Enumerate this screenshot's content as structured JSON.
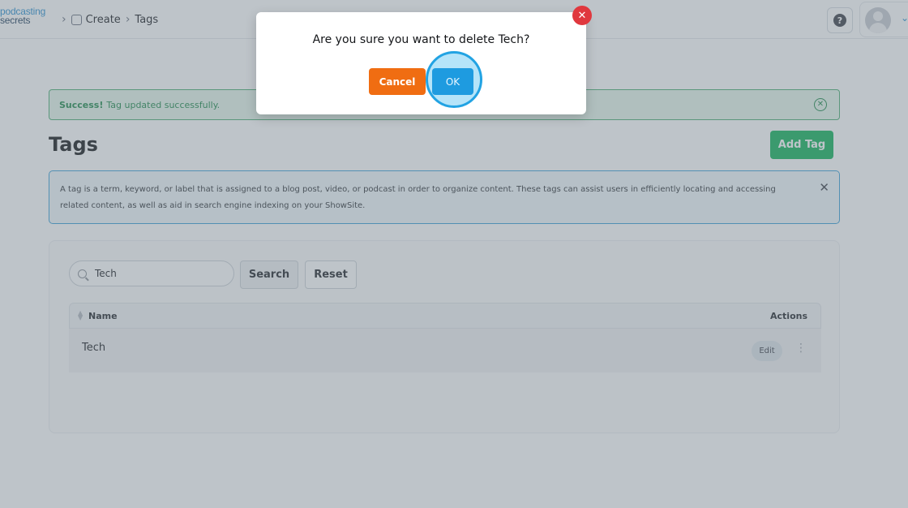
{
  "header": {
    "logo_line1": "podcasting",
    "logo_line2": "secrets",
    "breadcrumb": [
      "Create",
      "Tags"
    ],
    "help_label": "?"
  },
  "alert": {
    "strong": "Success!",
    "text": "Tag updated successfully."
  },
  "page": {
    "title": "Tags",
    "add_button": "Add Tag"
  },
  "info": {
    "text": "A tag is a term, keyword, or label that is assigned to a blog post, video, or podcast in order to organize content. These tags can assist users in efficiently locating and accessing related content, as well as aid in search engine indexing on your ShowSite."
  },
  "search": {
    "value": "Tech",
    "search_button": "Search",
    "reset_button": "Reset"
  },
  "table": {
    "columns": [
      "Name",
      "Actions"
    ],
    "rows": [
      {
        "name": "Tech",
        "edit_label": "Edit"
      }
    ]
  },
  "modal": {
    "message": "Are you sure you want to delete Tech?",
    "cancel_label": "Cancel",
    "ok_label": "OK"
  },
  "colors": {
    "primary": "#1e9be0",
    "success": "#12b35a",
    "danger": "#e0383e",
    "cancel": "#f06d12"
  }
}
